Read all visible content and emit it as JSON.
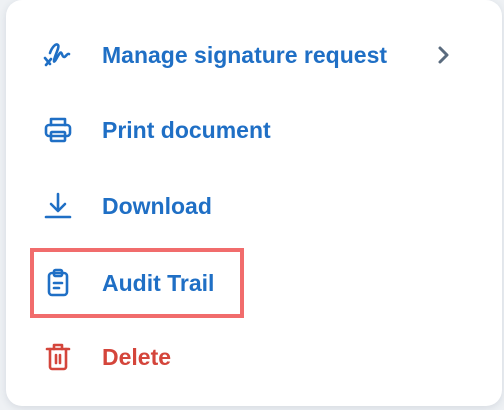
{
  "menu": {
    "items": [
      {
        "label": "Manage signature request",
        "icon": "signature-icon",
        "color": "#1f6fc5",
        "has_submenu": true,
        "submenu_icon": "chevron-right-icon",
        "submenu_icon_color": "#5a6b7e"
      },
      {
        "label": "Print document",
        "icon": "printer-icon",
        "color": "#1f6fc5"
      },
      {
        "label": "Download",
        "icon": "download-icon",
        "color": "#1f6fc5"
      },
      {
        "label": "Audit Trail",
        "icon": "clipboard-icon",
        "color": "#1f6fc5",
        "highlighted": true
      },
      {
        "label": "Delete",
        "icon": "trash-icon",
        "color": "#d4453b"
      }
    ]
  },
  "colors": {
    "accent_blue": "#1f6fc5",
    "danger_red": "#d4453b",
    "highlight_border": "#f16c6c",
    "chevron_gray": "#5a6b7e"
  }
}
